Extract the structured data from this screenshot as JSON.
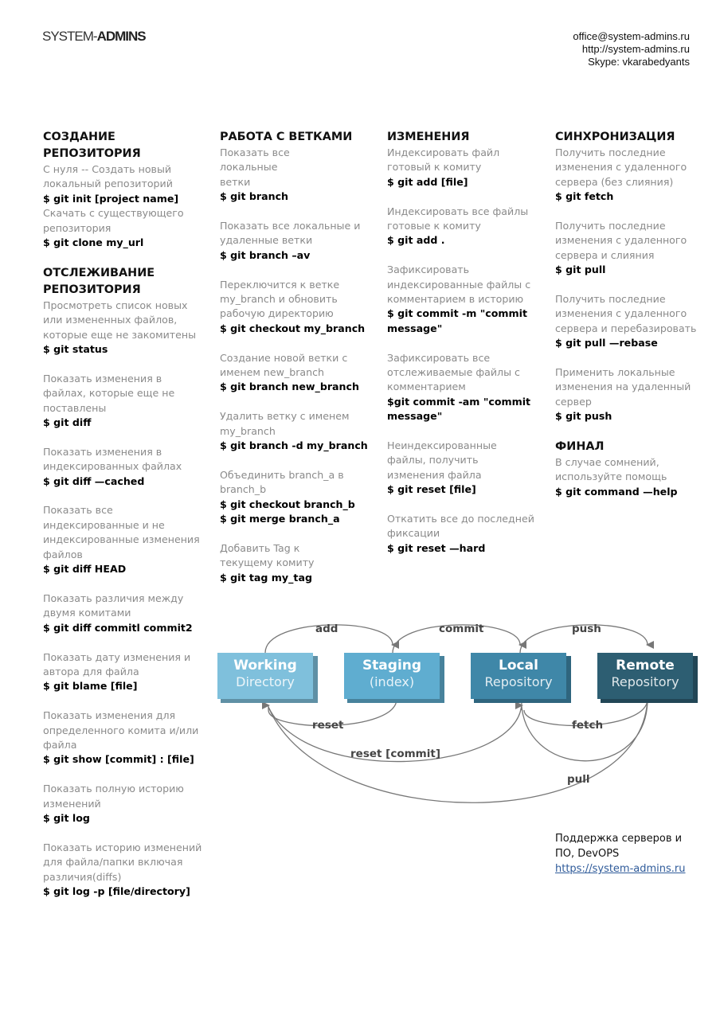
{
  "header": {
    "logo_light": "SYSTEM-",
    "logo_bold": "ADMINS",
    "contact": [
      "office@system-admins.ru",
      "http://system-admins.ru",
      "Skype: vkarabedyants"
    ]
  },
  "columns": [
    {
      "sections": [
        {
          "title": "СОЗДАНИЕ\nРЕПОЗИТОРИЯ",
          "items": [
            {
              "desc": "С нуля     -- Создать новый\nлокальный репозиторий",
              "cmd": "$ git init [project name]",
              "tight": true
            },
            {
              "desc": "Скачать с существующего\nрепозитория",
              "cmd": "$ git clone my_url"
            }
          ]
        },
        {
          "title": "ОТСЛЕЖИВАНИЕ\nРЕПОЗИТОРИЯ",
          "items": [
            {
              "desc": "Просмотреть список новых\nили измененных файлов,\nкоторые еще не закомитены",
              "cmd": "$ git status"
            },
            {
              "desc": "Показать изменения в\nфайлах, которые еще не\nпоставлены",
              "cmd": "$ git diff"
            },
            {
              "desc": "Показать изменения в\nиндексированных файлах",
              "cmd": "$ git diff —cached"
            },
            {
              "desc": "Показать все\nиндексированные и не\nиндексированные изменения\nфайлов",
              "cmd": "$ git diff HEAD"
            },
            {
              "desc": "Показать различия между\nдвумя комитами",
              "cmd": "$ git diff commitl commit2"
            },
            {
              "desc": "Показать дату изменения и\nавтора для файла",
              "cmd": "$ git blame [file]"
            },
            {
              "desc": "Показать изменения для\nопределенного комита и/или\nфайла",
              "cmd": "$ git show [commit] : [file]"
            },
            {
              "desc": "Показать полную историю\nизменений",
              "cmd": "$ git log"
            },
            {
              "desc": "Показать историю изменений\nдля файла/папки включая\nразличия(diffs)",
              "cmd": "$ git log -p [file/directory]"
            }
          ]
        }
      ]
    },
    {
      "sections": [
        {
          "title": "РАБОТА С ВЕТКАМИ",
          "items": [
            {
              "desc": "Показать все\nлокальные\nветки",
              "cmd": "$ git branch"
            },
            {
              "desc": "Показать все локальные и\nудаленные ветки",
              "cmd": "$ git branch –av"
            },
            {
              "desc": "Переключится к ветке\nmy_branch и обновить\nрабочую директорию",
              "cmd": "$ git checkout my_branch"
            },
            {
              "desc": "Создание новой ветки с\nименем new_branch",
              "cmd": "$ git branch new_branch"
            },
            {
              "desc": "Удалить ветку с именем\nmy_branch",
              "cmd": "$ git branch -d my_branch"
            },
            {
              "desc": "Объединить branch_a в\nbranch_b",
              "cmd": "$ git checkout branch_b\n$ git merge branch_a"
            },
            {
              "desc": "Добавить Tag к\nтекущему комиту",
              "cmd": "$ git tag my_tag"
            }
          ]
        }
      ]
    },
    {
      "sections": [
        {
          "title": "ИЗМЕНЕНИЯ",
          "items": [
            {
              "desc": "Индексировать файл\nготовый к комиту",
              "cmd": "$ git add [file]"
            },
            {
              "desc": "Индексировать все файлы\nготовые к комиту",
              "cmd": "$ git add ."
            },
            {
              "desc": "Зафиксировать\nиндексированные файлы с\nкомментарием в историю",
              "cmd": "$ git commit -m \"commit\nmessage\""
            },
            {
              "desc": "Зафиксировать все\nотслеживаемые файлы с\nкомментарием",
              "cmd": "$git commit -am \"commit\nmessage\""
            },
            {
              "desc": "Неиндексированные\nфайлы, получить\nизменения файла",
              "cmd": "$ git reset [file]"
            },
            {
              "desc": "Откатить все до последней\nфиксации",
              "cmd": "$ git reset —hard"
            }
          ]
        }
      ]
    },
    {
      "sections": [
        {
          "title": "СИНХРОНИЗАЦИЯ",
          "items": [
            {
              "desc": "Получить последние\nизменения с удаленного\nсервера (без слияния)",
              "cmd": "$ git fetch"
            },
            {
              "desc": "Получить последние\nизменения с удаленного\nсервера и слияния",
              "cmd": "$ git pull"
            },
            {
              "desc": "Получить последние\nизменения с удаленного\nсервера и перебазировать",
              "cmd": "$ git pull —rebase"
            },
            {
              "desc": "Применить локальные\nизменения на удаленный\nсервер",
              "cmd": "$ git push"
            }
          ]
        },
        {
          "title": "ФИНАЛ",
          "items": [
            {
              "desc": "В случае сомнений,\nиспользуйте помощь",
              "cmd": "$ git command —help"
            }
          ]
        }
      ]
    }
  ],
  "diagram": {
    "boxes": [
      {
        "id": "working",
        "line1": "Working",
        "line2": "Directory",
        "color": "#7fc0dc"
      },
      {
        "id": "staging",
        "line1": "Staging",
        "line2": "(index)",
        "color": "#5fadd0"
      },
      {
        "id": "local",
        "line1": "Local",
        "line2": "Repository",
        "color": "#3f87a8"
      },
      {
        "id": "remote",
        "line1": "Remote",
        "line2": "Repository",
        "color": "#2d5e72"
      }
    ],
    "arrows": {
      "add": "add",
      "commit": "commit",
      "push": "push",
      "reset": "reset",
      "fetch": "fetch",
      "reset_commit": "reset [commit]",
      "pull": "pull"
    }
  },
  "footer": {
    "line1": "Поддержка серверов и",
    "line2": "ПО, DevOPS",
    "link": "https://system-admins.ru"
  }
}
